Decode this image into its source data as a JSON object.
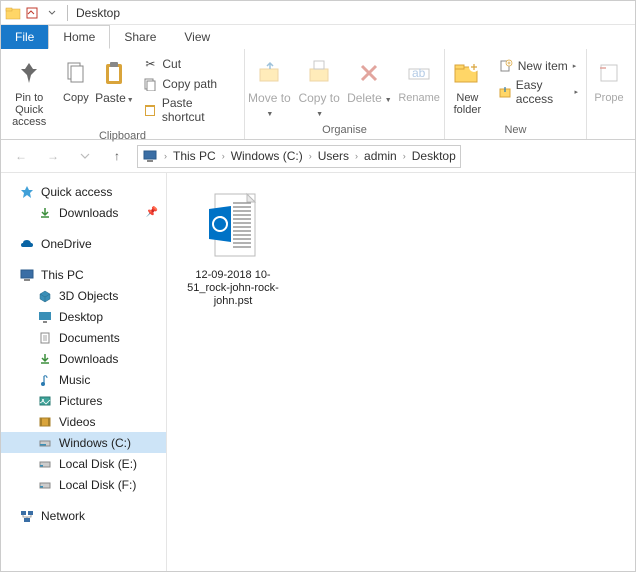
{
  "title": "Desktop",
  "tabs": {
    "file": "File",
    "home": "Home",
    "share": "Share",
    "view": "View"
  },
  "ribbon": {
    "clipboard": {
      "label": "Clipboard",
      "pin": "Pin to Quick access",
      "copy": "Copy",
      "paste": "Paste",
      "cut": "Cut",
      "copypath": "Copy path",
      "pasteshortcut": "Paste shortcut"
    },
    "organise": {
      "label": "Organise",
      "moveto": "Move to",
      "copyto": "Copy to",
      "delete": "Delete",
      "rename": "Rename"
    },
    "new": {
      "label": "New",
      "newfolder": "New folder",
      "newitem": "New item",
      "easyaccess": "Easy access"
    },
    "open": {
      "properties": "Prope"
    }
  },
  "breadcrumb": [
    "This PC",
    "Windows (C:)",
    "Users",
    "admin",
    "Desktop"
  ],
  "sidebar": {
    "quickaccess": "Quick access",
    "downloads_qa": "Downloads",
    "onedrive": "OneDrive",
    "thispc": "This PC",
    "objects3d": "3D Objects",
    "desktop": "Desktop",
    "documents": "Documents",
    "downloads": "Downloads",
    "music": "Music",
    "pictures": "Pictures",
    "videos": "Videos",
    "windowsc": "Windows (C:)",
    "diske": "Local Disk (E:)",
    "diskf": "Local Disk (F:)",
    "network": "Network"
  },
  "files": [
    {
      "name": "12-09-2018 10-51_rock-john-rock-john.pst"
    }
  ]
}
